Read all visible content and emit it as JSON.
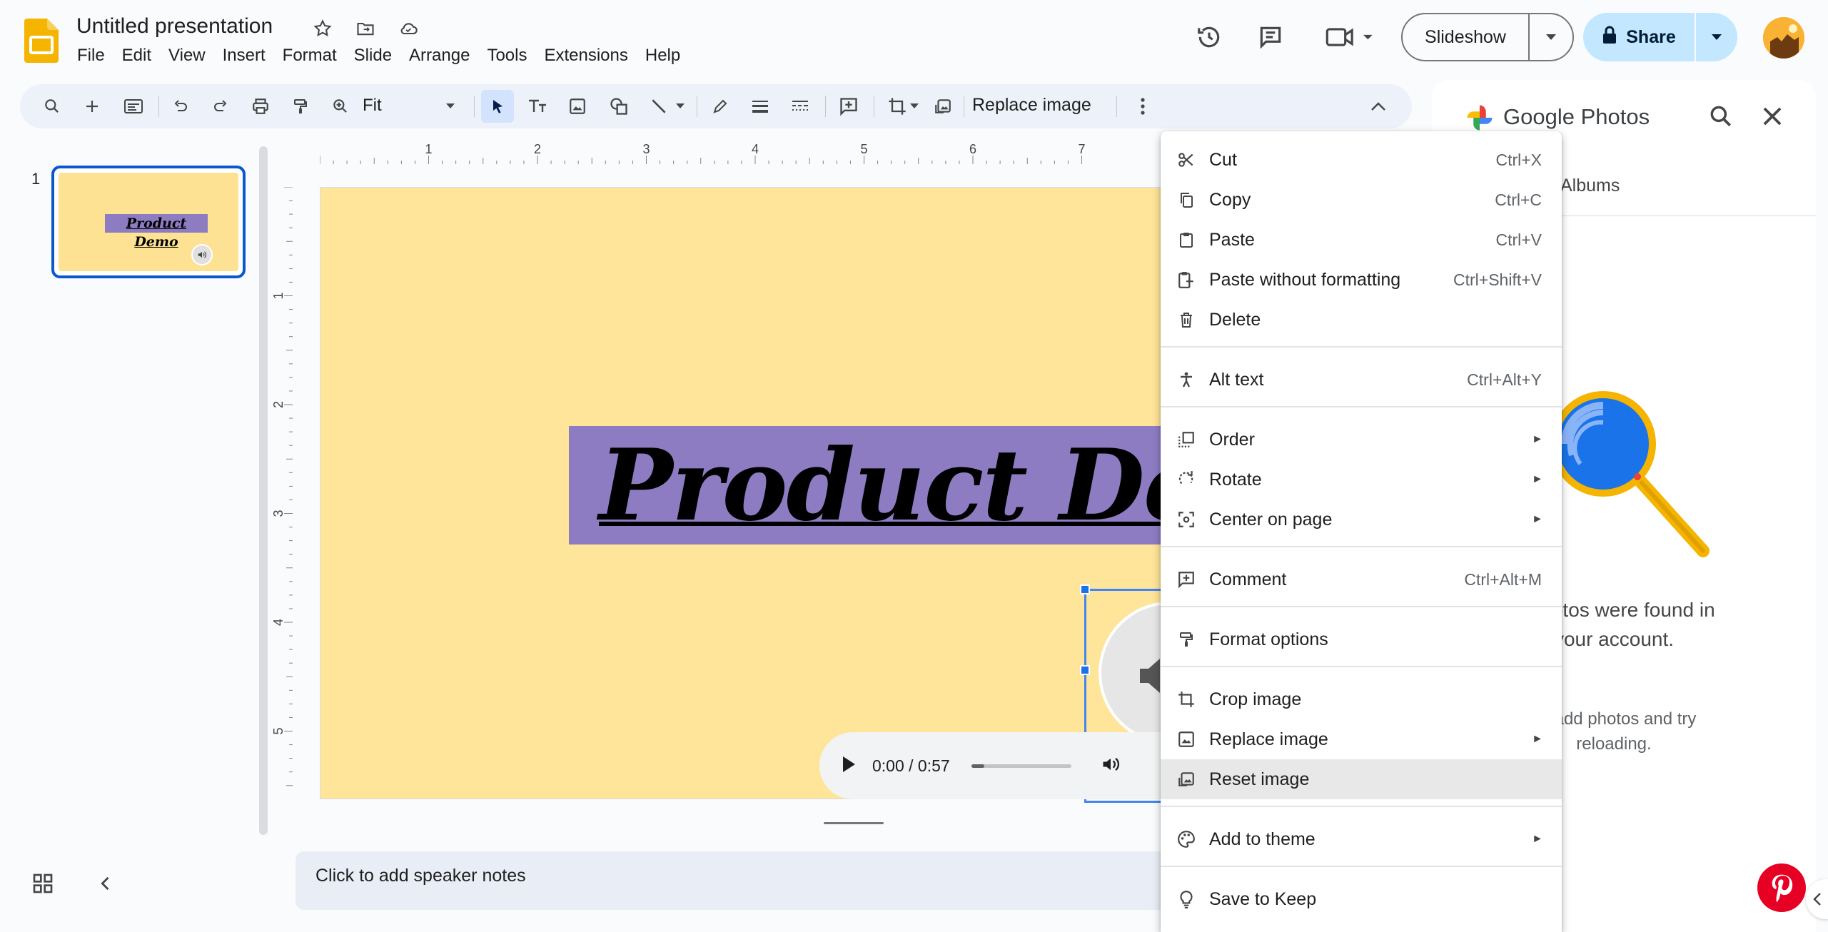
{
  "app": {
    "title": "Untitled presentation",
    "menu": [
      "File",
      "Edit",
      "View",
      "Insert",
      "Format",
      "Slide",
      "Arrange",
      "Tools",
      "Extensions",
      "Help"
    ],
    "slideshow_label": "Slideshow",
    "share_label": "Share"
  },
  "toolbar": {
    "zoom_value": "Fit",
    "replace_image_label": "Replace image"
  },
  "filmstrip": {
    "slide_number": "1",
    "thumb_title": "Product Demo"
  },
  "ruler": {
    "h_ticks": [
      "1",
      "2",
      "3",
      "4",
      "5",
      "6",
      "7"
    ],
    "v_ticks": [
      "1",
      "2",
      "3",
      "4",
      "5"
    ]
  },
  "slide": {
    "title": "Product Demo",
    "background_color": "#ffe599",
    "title_box_color": "#8e7cc3"
  },
  "player": {
    "time": "0:00 / 0:57",
    "progress": 0.0
  },
  "notes": {
    "placeholder": "Click to add speaker notes"
  },
  "side_panel": {
    "title": "Google Photos",
    "tab": "Albums",
    "empty_message_visible": "o photos were found in your account.",
    "empty_hint_visible": "se add photos and try reloading."
  },
  "context_menu": {
    "items": [
      {
        "label": "Cut",
        "shortcut": "Ctrl+X",
        "icon": "scissors-icon"
      },
      {
        "label": "Copy",
        "shortcut": "Ctrl+C",
        "icon": "copy-icon"
      },
      {
        "label": "Paste",
        "shortcut": "Ctrl+V",
        "icon": "clipboard-icon"
      },
      {
        "label": "Paste without formatting",
        "shortcut": "Ctrl+Shift+V",
        "icon": "paste-plain-icon"
      },
      {
        "label": "Delete",
        "shortcut": "",
        "icon": "trash-icon"
      },
      {
        "label": "Alt text",
        "shortcut": "Ctrl+Alt+Y",
        "icon": "accessibility-icon"
      },
      {
        "label": "Order",
        "shortcut": "",
        "icon": "order-icon",
        "submenu": true
      },
      {
        "label": "Rotate",
        "shortcut": "",
        "icon": "rotate-icon",
        "submenu": true
      },
      {
        "label": "Center on page",
        "shortcut": "",
        "icon": "center-icon",
        "submenu": true
      },
      {
        "label": "Comment",
        "shortcut": "Ctrl+Alt+M",
        "icon": "comment-add-icon"
      },
      {
        "label": "Format options",
        "shortcut": "",
        "icon": "format-paint-icon"
      },
      {
        "label": "Crop image",
        "shortcut": "",
        "icon": "crop-icon"
      },
      {
        "label": "Replace image",
        "shortcut": "",
        "icon": "image-icon",
        "submenu": true
      },
      {
        "label": "Reset image",
        "shortcut": "",
        "icon": "reset-image-icon",
        "highlighted": true
      },
      {
        "label": "Add to theme",
        "shortcut": "",
        "icon": "palette-icon",
        "submenu": true
      },
      {
        "label": "Save to Keep",
        "shortcut": "",
        "icon": "lightbulb-icon"
      }
    ]
  },
  "colors": {
    "accent": "#0b57d0",
    "share_bg": "#c2e7ff",
    "slides_logo": "#f4b400"
  }
}
